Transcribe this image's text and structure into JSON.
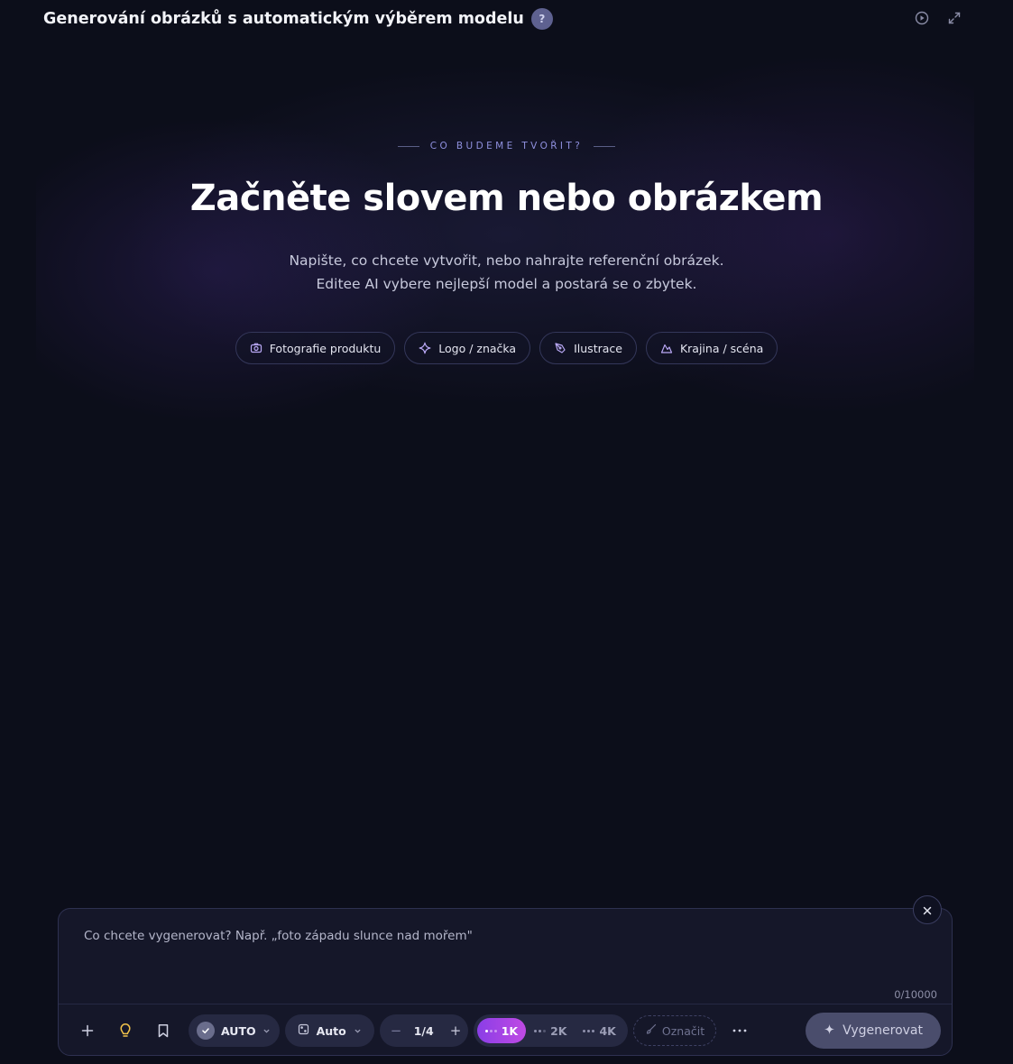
{
  "header": {
    "title": "Generování obrázků s automatickým výběrem modelu",
    "help_label": "?",
    "icons": [
      "play-circle-icon",
      "expand-icon"
    ]
  },
  "hero": {
    "eyebrow": "CO BUDEME TVOŘIT?",
    "title": "Začněte slovem nebo obrázkem",
    "subtitle_line1": "Napište, co chcete vytvořit, nebo nahrajte referenční obrázek.",
    "subtitle_line2": "Editee AI vybere nejlepší model a postará se o zbytek."
  },
  "chips": [
    {
      "label": "Fotografie produktu",
      "icon": "camera-icon"
    },
    {
      "label": "Logo / značka",
      "icon": "sparkle-icon"
    },
    {
      "label": "Ilustrace",
      "icon": "pen-nib-icon"
    },
    {
      "label": "Krajina / scéna",
      "icon": "mountain-icon"
    }
  ],
  "composer": {
    "placeholder": "Co chcete vygenerovat? Např. „foto západu slunce nad mořem\"",
    "value": "",
    "char_count": "0/10000",
    "toolbar": {
      "model_label": "AUTO",
      "ratio_label": "Auto",
      "count_label": "1/4",
      "count_minus": "−",
      "count_plus": "+",
      "resolutions": [
        {
          "label": "1K",
          "active": true
        },
        {
          "label": "2K",
          "active": false
        },
        {
          "label": "4K",
          "active": false
        }
      ],
      "mark_label": "Označit",
      "more_label": "···",
      "generate_label": "Vygenerovat"
    }
  },
  "colors": {
    "background": "#0c0e1a",
    "accent_gradient_start": "#8a3ee6",
    "accent_gradient_end": "#c04ae4",
    "eyebrow": "#8f90de",
    "bulb": "#f1c24a"
  }
}
